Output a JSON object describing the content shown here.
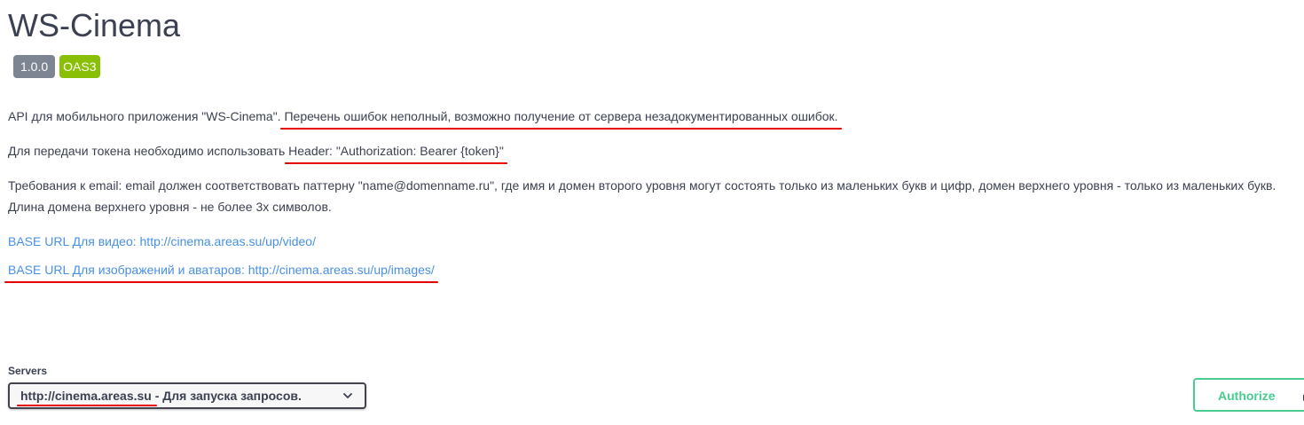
{
  "info": {
    "title": "WS-Cinema",
    "version_badge": "1.0.0",
    "spec_badge": "OAS3"
  },
  "description": {
    "p1_prefix": "API для мобильного приложения \"WS-Cinema\". ",
    "p1_highlight": "Перечень ошибок неполный, возможно получение от сервера незадокументированных ошибок.",
    "p2_prefix": "Для передачи токена необходимо использовать ",
    "p2_highlight": "Header: \"Authorization: Bearer {token}\"",
    "p3": "Требования к email: email должен соответствовать паттерну \"name@domenname.ru\", где имя и домен второго уровня могут состоять только из маленьких букв и цифр, домен верхнего уровня - только из маленьких букв. Длина домена верхнего уровня - не более 3х символов.",
    "link_video": "BASE URL Для видео: http://cinema.areas.su/up/video/",
    "link_images": "BASE URL Для изображений и аватаров: http://cinema.areas.su/up/images/"
  },
  "servers": {
    "label": "Servers",
    "selected_url": "http://cinema.areas.su",
    "selected_desc": " - Для запуска запросов."
  },
  "authorize": {
    "label": "Authorize"
  },
  "colors": {
    "text": "#3b4151",
    "link": "#4990e2",
    "highlight_underline": "#e60000",
    "authorize_green": "#49cc90",
    "version_badge_bg": "#7d8492",
    "oas_badge_bg": "#89bf04"
  },
  "icons": {
    "chevron": "chevron-down-icon",
    "lock": "lock-icon"
  }
}
